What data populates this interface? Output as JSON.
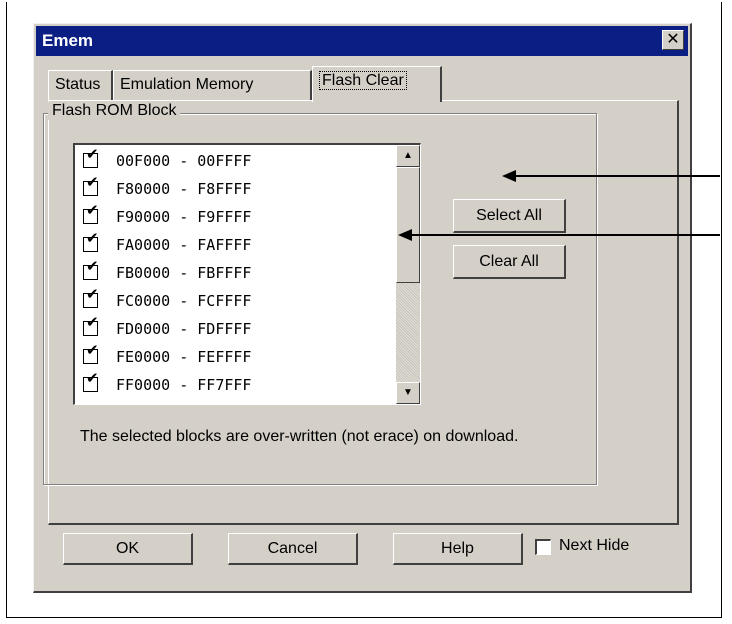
{
  "window": {
    "title": "Emem",
    "close_glyph": "✕"
  },
  "tabs": [
    {
      "label": "Status",
      "active": false
    },
    {
      "label": "Emulation Memory",
      "active": false
    },
    {
      "label": "Flash Clear",
      "active": true
    }
  ],
  "group": {
    "label": "Flash ROM Block"
  },
  "blocks": [
    {
      "range": "00F000  -  00FFFF",
      "checked": true
    },
    {
      "range": "F80000  -  F8FFFF",
      "checked": true
    },
    {
      "range": "F90000  -  F9FFFF",
      "checked": true
    },
    {
      "range": "FA0000  -  FAFFFF",
      "checked": true
    },
    {
      "range": "FB0000  -  FBFFFF",
      "checked": true
    },
    {
      "range": "FC0000  -  FCFFFF",
      "checked": true
    },
    {
      "range": "FD0000  -  FDFFFF",
      "checked": true
    },
    {
      "range": "FE0000  -  FEFFFF",
      "checked": true
    },
    {
      "range": "FF0000  -  FF7FFF",
      "checked": true
    }
  ],
  "check_glyph": "✔",
  "buttons": {
    "select_all": "Select All",
    "clear_all": "Clear All",
    "ok": "OK",
    "cancel": "Cancel",
    "help": "Help"
  },
  "note": "The selected blocks are over-written (not erace) on download.",
  "next_hide": {
    "label": "Next Hide",
    "checked": false
  },
  "icons": {
    "scroll_up": "▲",
    "scroll_down": "▼"
  }
}
